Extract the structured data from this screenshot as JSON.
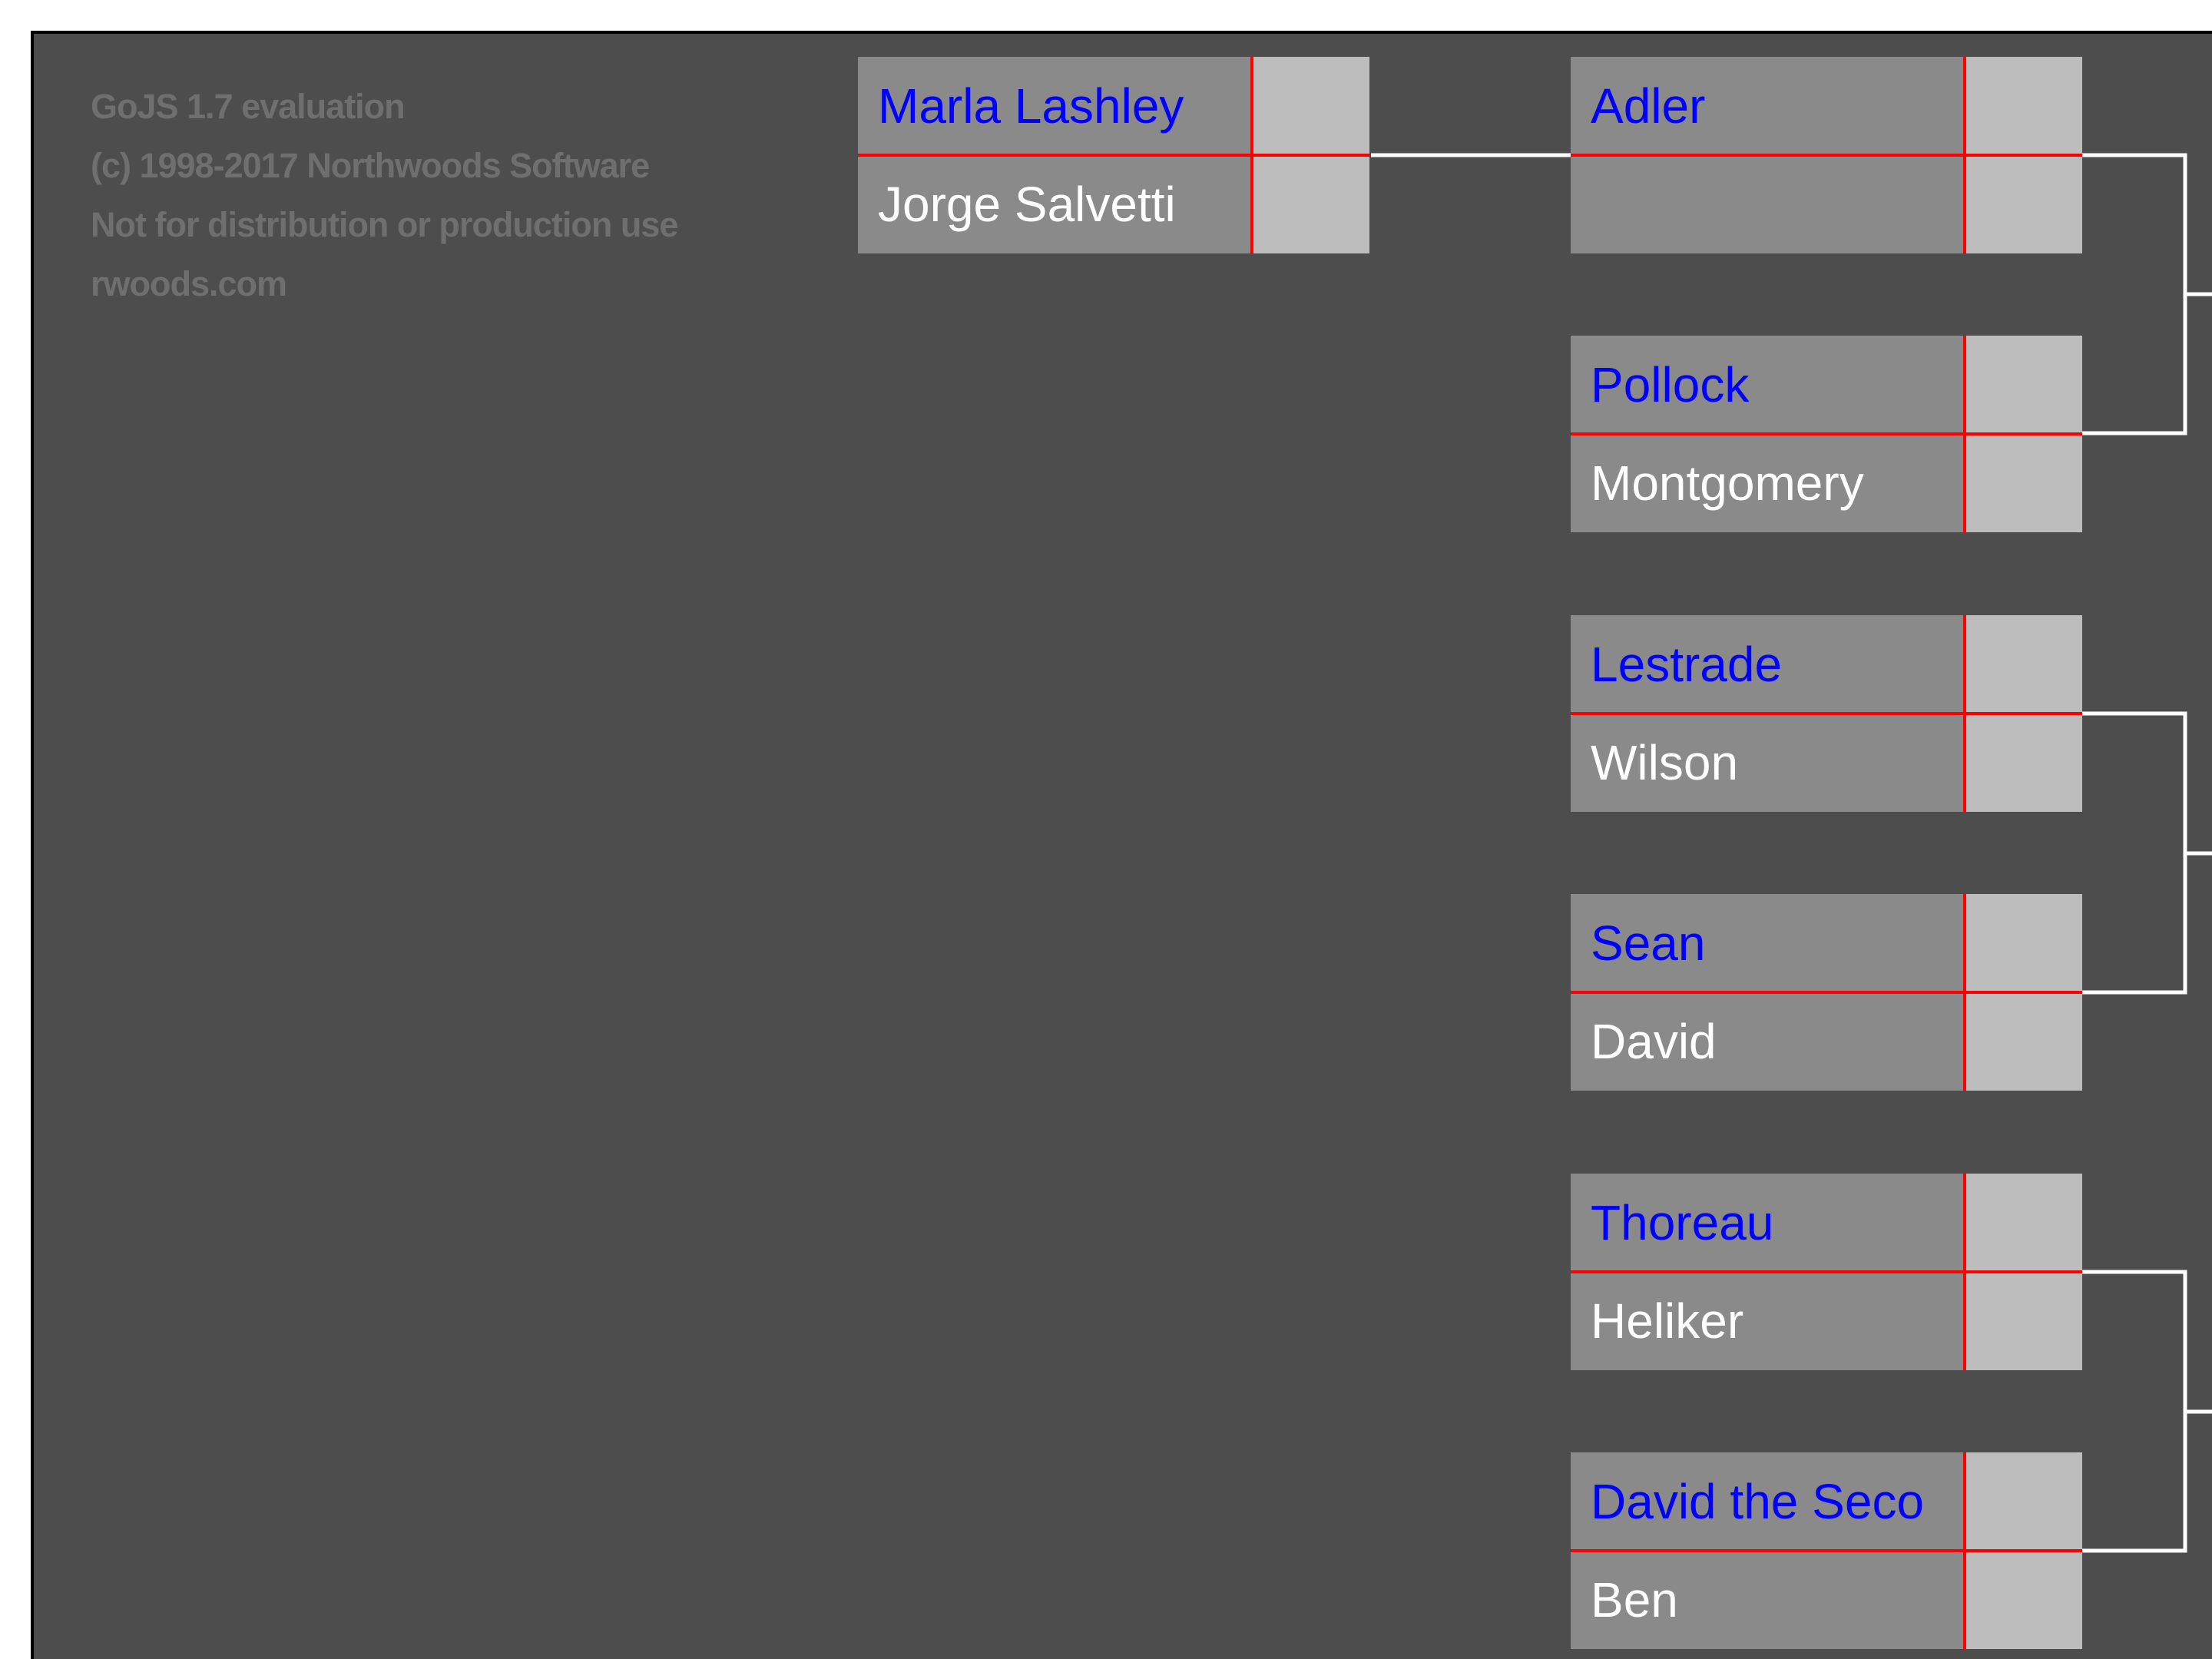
{
  "watermark": {
    "lines": [
      "GoJS 1.7 evaluation",
      "(c) 1998-2017 Northwoods Software",
      "Not for distribution or production use",
      "rwoods.com"
    ]
  },
  "bracket": {
    "round1": [
      {
        "top": "Marla Lashley",
        "bottom": "Jorge Salvetti"
      }
    ],
    "round2": [
      {
        "top": "Adler",
        "bottom": ""
      },
      {
        "top": "Pollock",
        "bottom": "Montgomery"
      },
      {
        "top": "Lestrade",
        "bottom": "Wilson"
      },
      {
        "top": "Sean",
        "bottom": "David"
      },
      {
        "top": "Thoreau",
        "bottom": "Heliker"
      },
      {
        "top": "David the Seco",
        "bottom": "Ben"
      }
    ]
  },
  "colors": {
    "background": "#4d4d4d",
    "name_cell": "#8a8a8a",
    "score_cell": "#bdbdbd",
    "divider": "#ff0000",
    "link": "#ffffff",
    "top_player_text": "#0000ff",
    "bottom_player_text": "#ffffff"
  }
}
